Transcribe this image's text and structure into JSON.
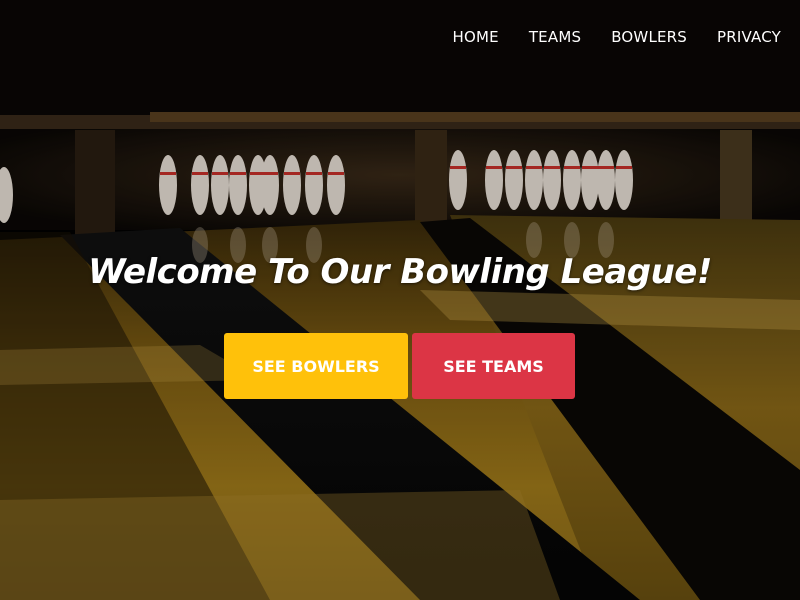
{
  "nav": {
    "items": [
      {
        "label": "HOME"
      },
      {
        "label": "TEAMS"
      },
      {
        "label": "BOWLERS"
      },
      {
        "label": "PRIVACY"
      }
    ]
  },
  "hero": {
    "headline": "Welcome To Our Bowling League!",
    "buttons": {
      "see_bowlers": "SEE BOWLERS",
      "see_teams": "SEE TEAMS"
    }
  },
  "colors": {
    "bowlers_button": "#FFC10A",
    "teams_button": "#DC3545",
    "nav_text": "#FFFFFF"
  }
}
